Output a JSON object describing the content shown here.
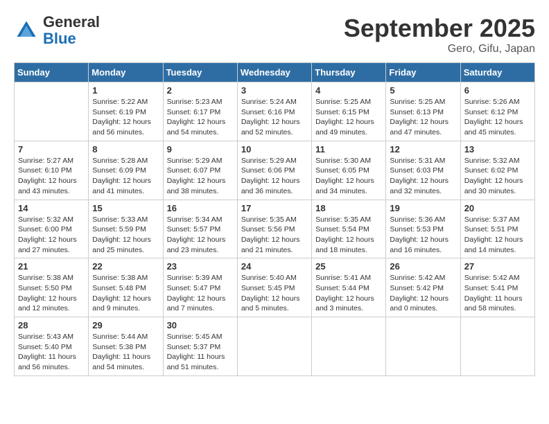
{
  "header": {
    "logo_general": "General",
    "logo_blue": "Blue",
    "month_title": "September 2025",
    "subtitle": "Gero, Gifu, Japan"
  },
  "calendar": {
    "days_of_week": [
      "Sunday",
      "Monday",
      "Tuesday",
      "Wednesday",
      "Thursday",
      "Friday",
      "Saturday"
    ],
    "weeks": [
      [
        {
          "day": "",
          "info": ""
        },
        {
          "day": "1",
          "info": "Sunrise: 5:22 AM\nSunset: 6:19 PM\nDaylight: 12 hours\nand 56 minutes."
        },
        {
          "day": "2",
          "info": "Sunrise: 5:23 AM\nSunset: 6:17 PM\nDaylight: 12 hours\nand 54 minutes."
        },
        {
          "day": "3",
          "info": "Sunrise: 5:24 AM\nSunset: 6:16 PM\nDaylight: 12 hours\nand 52 minutes."
        },
        {
          "day": "4",
          "info": "Sunrise: 5:25 AM\nSunset: 6:15 PM\nDaylight: 12 hours\nand 49 minutes."
        },
        {
          "day": "5",
          "info": "Sunrise: 5:25 AM\nSunset: 6:13 PM\nDaylight: 12 hours\nand 47 minutes."
        },
        {
          "day": "6",
          "info": "Sunrise: 5:26 AM\nSunset: 6:12 PM\nDaylight: 12 hours\nand 45 minutes."
        }
      ],
      [
        {
          "day": "7",
          "info": "Sunrise: 5:27 AM\nSunset: 6:10 PM\nDaylight: 12 hours\nand 43 minutes."
        },
        {
          "day": "8",
          "info": "Sunrise: 5:28 AM\nSunset: 6:09 PM\nDaylight: 12 hours\nand 41 minutes."
        },
        {
          "day": "9",
          "info": "Sunrise: 5:29 AM\nSunset: 6:07 PM\nDaylight: 12 hours\nand 38 minutes."
        },
        {
          "day": "10",
          "info": "Sunrise: 5:29 AM\nSunset: 6:06 PM\nDaylight: 12 hours\nand 36 minutes."
        },
        {
          "day": "11",
          "info": "Sunrise: 5:30 AM\nSunset: 6:05 PM\nDaylight: 12 hours\nand 34 minutes."
        },
        {
          "day": "12",
          "info": "Sunrise: 5:31 AM\nSunset: 6:03 PM\nDaylight: 12 hours\nand 32 minutes."
        },
        {
          "day": "13",
          "info": "Sunrise: 5:32 AM\nSunset: 6:02 PM\nDaylight: 12 hours\nand 30 minutes."
        }
      ],
      [
        {
          "day": "14",
          "info": "Sunrise: 5:32 AM\nSunset: 6:00 PM\nDaylight: 12 hours\nand 27 minutes."
        },
        {
          "day": "15",
          "info": "Sunrise: 5:33 AM\nSunset: 5:59 PM\nDaylight: 12 hours\nand 25 minutes."
        },
        {
          "day": "16",
          "info": "Sunrise: 5:34 AM\nSunset: 5:57 PM\nDaylight: 12 hours\nand 23 minutes."
        },
        {
          "day": "17",
          "info": "Sunrise: 5:35 AM\nSunset: 5:56 PM\nDaylight: 12 hours\nand 21 minutes."
        },
        {
          "day": "18",
          "info": "Sunrise: 5:35 AM\nSunset: 5:54 PM\nDaylight: 12 hours\nand 18 minutes."
        },
        {
          "day": "19",
          "info": "Sunrise: 5:36 AM\nSunset: 5:53 PM\nDaylight: 12 hours\nand 16 minutes."
        },
        {
          "day": "20",
          "info": "Sunrise: 5:37 AM\nSunset: 5:51 PM\nDaylight: 12 hours\nand 14 minutes."
        }
      ],
      [
        {
          "day": "21",
          "info": "Sunrise: 5:38 AM\nSunset: 5:50 PM\nDaylight: 12 hours\nand 12 minutes."
        },
        {
          "day": "22",
          "info": "Sunrise: 5:38 AM\nSunset: 5:48 PM\nDaylight: 12 hours\nand 9 minutes."
        },
        {
          "day": "23",
          "info": "Sunrise: 5:39 AM\nSunset: 5:47 PM\nDaylight: 12 hours\nand 7 minutes."
        },
        {
          "day": "24",
          "info": "Sunrise: 5:40 AM\nSunset: 5:45 PM\nDaylight: 12 hours\nand 5 minutes."
        },
        {
          "day": "25",
          "info": "Sunrise: 5:41 AM\nSunset: 5:44 PM\nDaylight: 12 hours\nand 3 minutes."
        },
        {
          "day": "26",
          "info": "Sunrise: 5:42 AM\nSunset: 5:42 PM\nDaylight: 12 hours\nand 0 minutes."
        },
        {
          "day": "27",
          "info": "Sunrise: 5:42 AM\nSunset: 5:41 PM\nDaylight: 11 hours\nand 58 minutes."
        }
      ],
      [
        {
          "day": "28",
          "info": "Sunrise: 5:43 AM\nSunset: 5:40 PM\nDaylight: 11 hours\nand 56 minutes."
        },
        {
          "day": "29",
          "info": "Sunrise: 5:44 AM\nSunset: 5:38 PM\nDaylight: 11 hours\nand 54 minutes."
        },
        {
          "day": "30",
          "info": "Sunrise: 5:45 AM\nSunset: 5:37 PM\nDaylight: 11 hours\nand 51 minutes."
        },
        {
          "day": "",
          "info": ""
        },
        {
          "day": "",
          "info": ""
        },
        {
          "day": "",
          "info": ""
        },
        {
          "day": "",
          "info": ""
        }
      ]
    ]
  }
}
